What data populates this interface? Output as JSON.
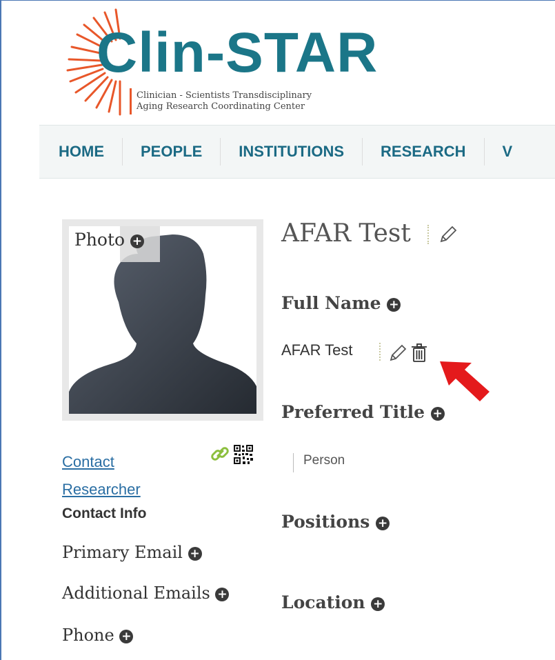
{
  "logo": {
    "title": "Clin-STAR",
    "subtitle_line1": "Clinician - Scientists Transdisciplinary",
    "subtitle_line2": "Aging Research Coordinating Center",
    "accent_color": "#1b7688",
    "ray_color": "#e8572a"
  },
  "nav": {
    "items": [
      "HOME",
      "PEOPLE",
      "INSTITUTIONS",
      "RESEARCH",
      "V"
    ]
  },
  "profile": {
    "photo_label": "Photo",
    "name": "AFAR Test",
    "full_name_label": "Full Name",
    "full_name_value": "AFAR Test",
    "preferred_title_label": "Preferred Title",
    "preferred_title_value": "Person",
    "positions_label": "Positions",
    "location_label": "Location"
  },
  "contact": {
    "link_line1": "Contact",
    "link_line2": "Researcher",
    "heading": "Contact Info",
    "primary_email_label": "Primary Email",
    "additional_emails_label": "Additional Emails",
    "phone_label": "Phone"
  },
  "icons": {
    "add": "+",
    "edit": "pencil-icon",
    "delete": "trash-icon",
    "link": "link-icon",
    "qr": "qr-code-icon"
  }
}
